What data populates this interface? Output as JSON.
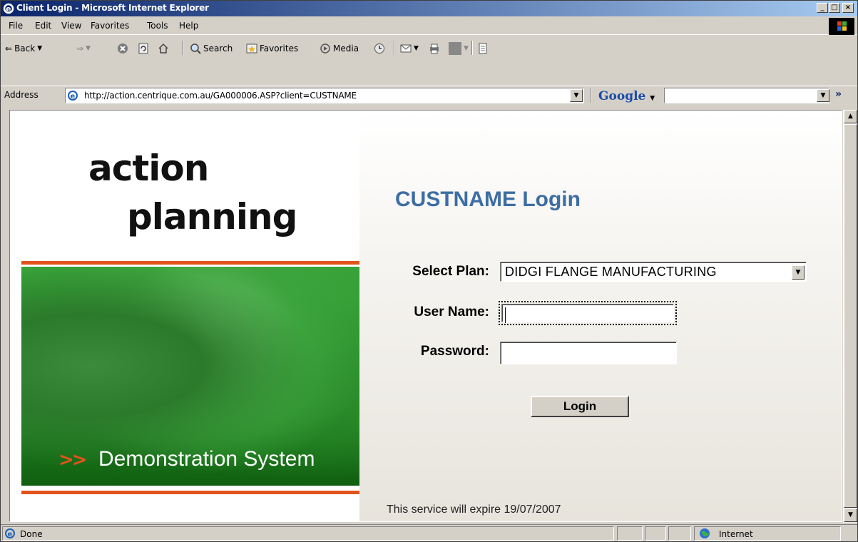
{
  "window": {
    "title": "Client Login - Microsoft Internet Explorer",
    "minimize": "_",
    "maximize": "□",
    "close": "×"
  },
  "menu": {
    "items": [
      "File",
      "Edit",
      "View",
      "Favorites",
      "Tools",
      "Help"
    ]
  },
  "toolbar": {
    "back": "Back",
    "search": "Search",
    "favorites": "Favorites",
    "media": "Media"
  },
  "address": {
    "label": "Address",
    "url": "http://action.centrique.com.au/GA000006.ASP?client=CUSTNAME",
    "google_label": "Google",
    "google_value": "",
    "more": "»"
  },
  "brand": {
    "logo_line1": "action",
    "logo_line2": "planning",
    "arrow": ">>",
    "tagline": "Demonstration System"
  },
  "login": {
    "title": "CUSTNAME Login",
    "plan_label": "Select Plan:",
    "plan_value": "DIDGI FLANGE MANUFACTURING",
    "username_label": "User Name:",
    "username_value": "",
    "password_label": "Password:",
    "password_value": "",
    "submit_label": "Login",
    "expiry_note": "This service will expire 19/07/2007"
  },
  "status": {
    "text": "Done",
    "zone": "Internet"
  }
}
